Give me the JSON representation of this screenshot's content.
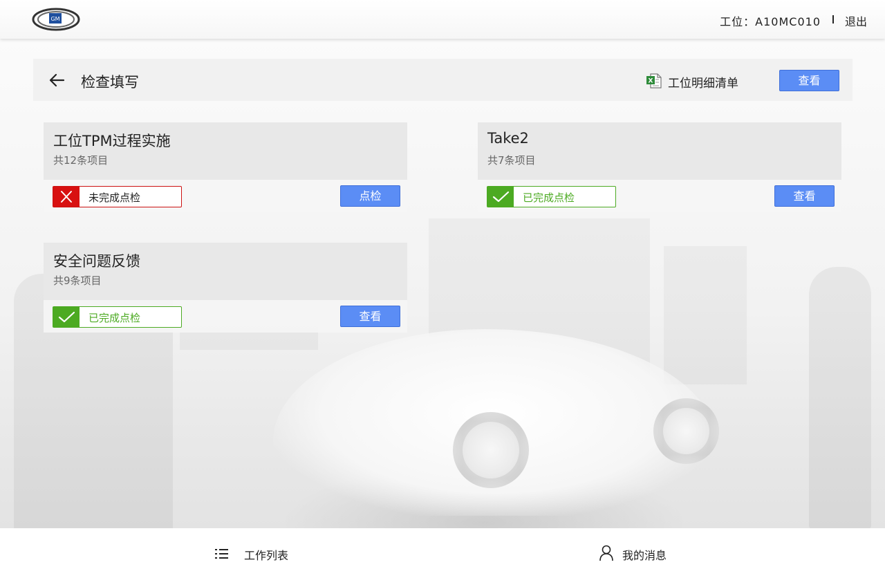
{
  "header": {
    "logo_text": "GM",
    "station_label": "工位：A10MC010",
    "logout_label": "退出"
  },
  "titlebar": {
    "title": "检查填写",
    "detail_list_label": "工位明细清单",
    "view_label": "查看"
  },
  "cards": [
    {
      "title": "工位TPM过程实施",
      "count": "共12条项目",
      "status": "未完成点检",
      "status_type": "incomplete",
      "action": "点检"
    },
    {
      "title": "Take2",
      "count": "共7条项目",
      "status": "已完成点检",
      "status_type": "complete",
      "action": "查看"
    },
    {
      "title": "安全问题反馈",
      "count": "共9条项目",
      "status": "已完成点检",
      "status_type": "complete",
      "action": "查看"
    }
  ],
  "bottom_nav": {
    "work_list": "工作列表",
    "my_messages": "我的消息"
  },
  "colors": {
    "accent_blue": "#5b8df5",
    "error_red": "#d81111",
    "success_green": "#4caa22"
  },
  "icons": {
    "back": "arrow-left-icon",
    "excel": "excel-file-icon",
    "incomplete": "close-icon",
    "complete": "check-icon",
    "work_list": "list-icon",
    "my_messages": "user-icon"
  }
}
